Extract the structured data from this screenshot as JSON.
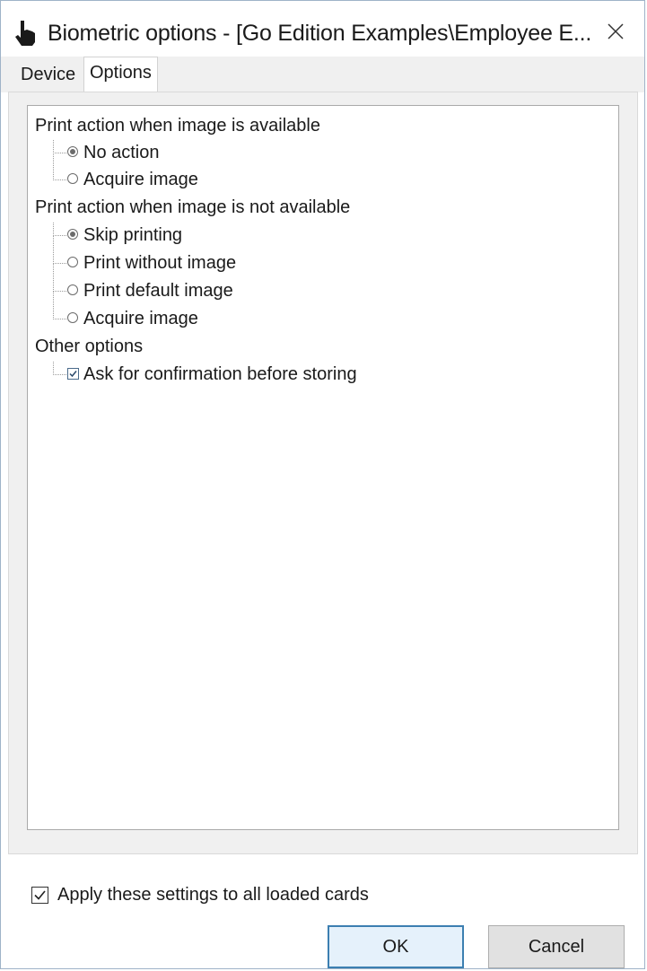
{
  "window": {
    "title": "Biometric options - [Go Edition Examples\\Employee E...",
    "close_glyph": "✕"
  },
  "tabs": [
    {
      "label": "Device",
      "selected": false
    },
    {
      "label": "Options",
      "selected": true
    }
  ],
  "tree": {
    "groups": [
      {
        "header": "Print action when image is available",
        "items": [
          {
            "label": "No action",
            "type": "radio",
            "checked": true
          },
          {
            "label": "Acquire image",
            "type": "radio",
            "checked": false
          }
        ]
      },
      {
        "header": "Print action when image is not available",
        "items": [
          {
            "label": "Skip printing",
            "type": "radio",
            "checked": true
          },
          {
            "label": "Print without image",
            "type": "radio",
            "checked": false
          },
          {
            "label": "Print default image",
            "type": "radio",
            "checked": false
          },
          {
            "label": "Acquire image",
            "type": "radio",
            "checked": false
          }
        ]
      },
      {
        "header": "Other options",
        "items": [
          {
            "label": "Ask for confirmation before storing",
            "type": "checkbox",
            "checked": true
          }
        ]
      }
    ]
  },
  "footer": {
    "apply_all_label": "Apply these settings to all loaded cards",
    "apply_all_checked": true,
    "ok_label": "OK",
    "cancel_label": "Cancel"
  },
  "colors": {
    "accent_border": "#3c7fb1",
    "dialog_background": "#f0f0f0"
  }
}
